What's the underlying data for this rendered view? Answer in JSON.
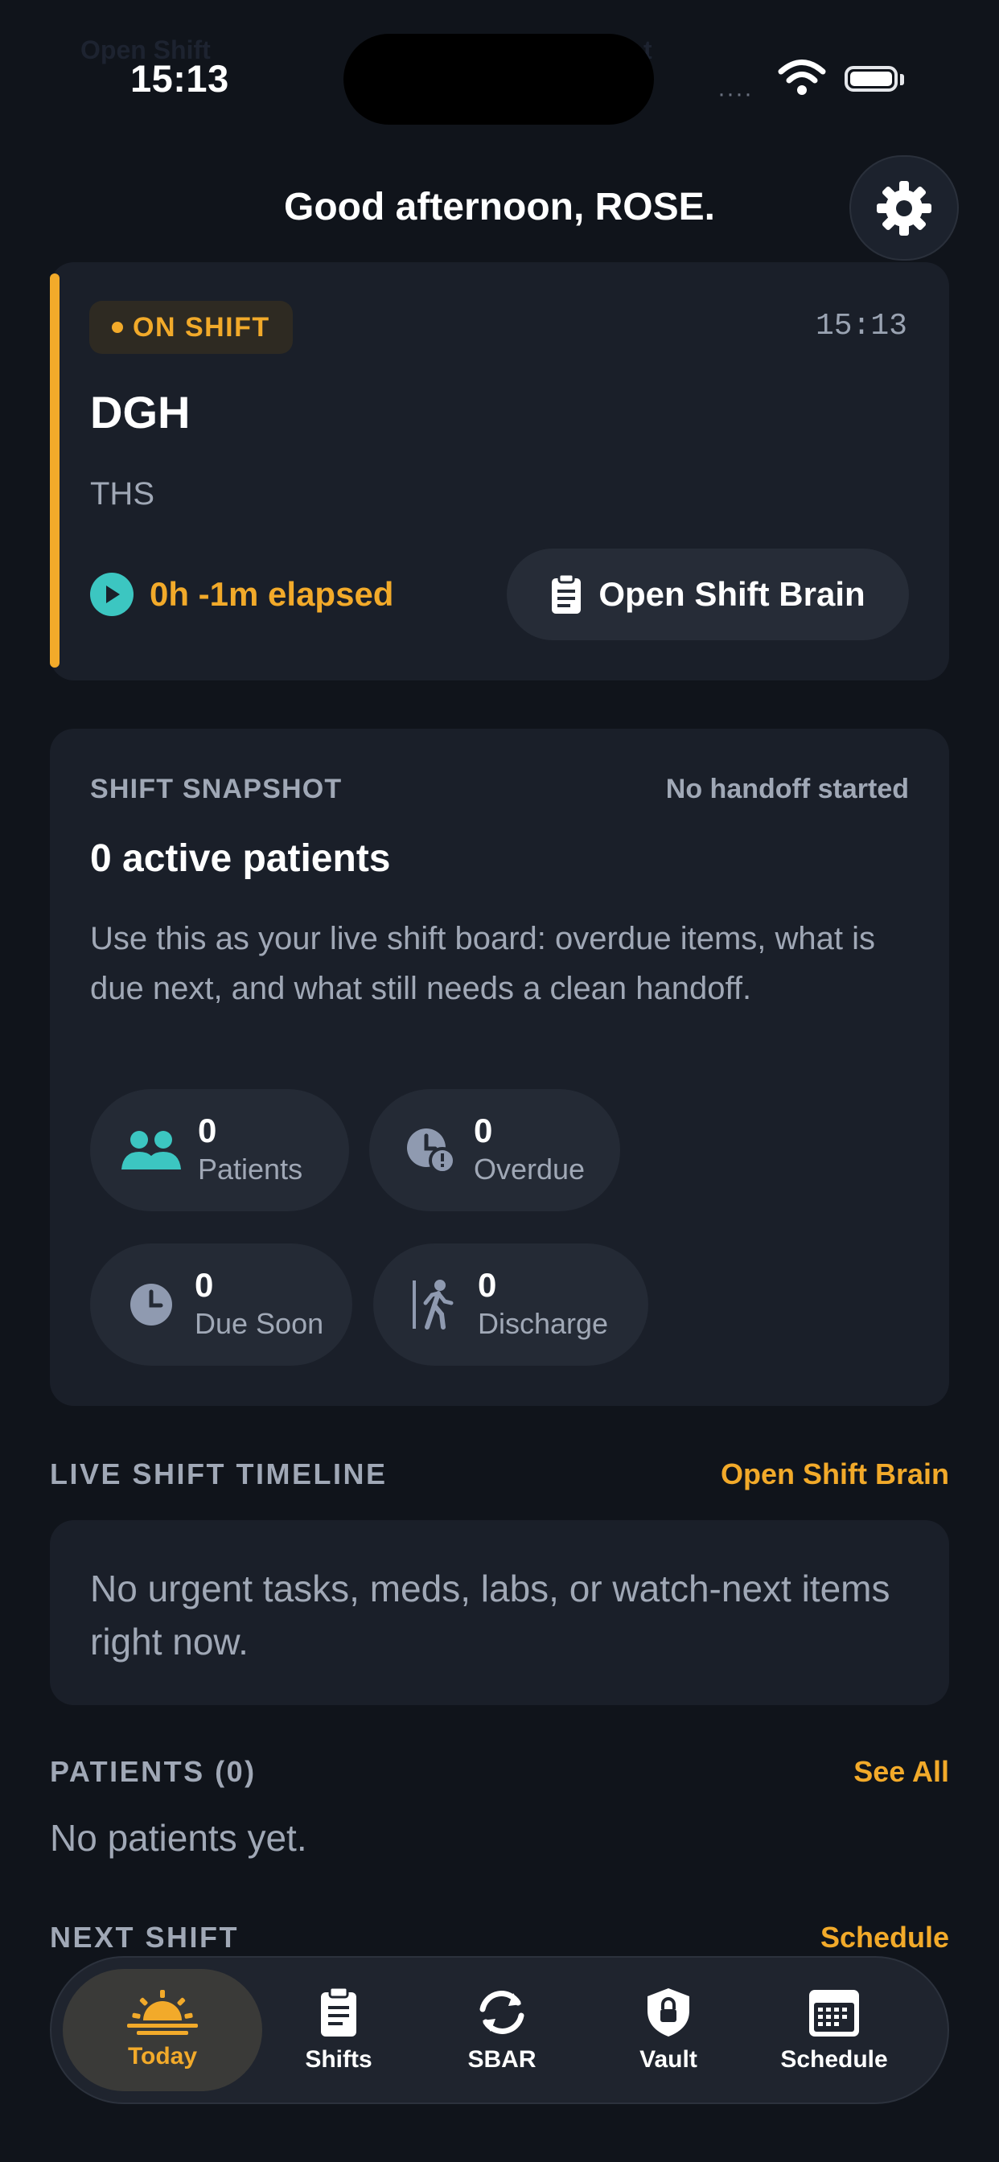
{
  "status_bar": {
    "time": "15:13",
    "signal": "····"
  },
  "greeting": "Good afternoon, ROSE.",
  "shift_card": {
    "badge": "ON SHIFT",
    "time": "15:13",
    "site": "DGH",
    "unit": "THS",
    "elapsed": "0h -1m elapsed",
    "open_brain_label": "Open Shift Brain"
  },
  "snapshot": {
    "label": "SHIFT SNAPSHOT",
    "handoff_status": "No handoff started",
    "active_patients": "0 active patients",
    "description": "Use this as your live shift board: overdue items, what is due next, and what still needs a clean handoff.",
    "stats": [
      {
        "value": "0",
        "label": "Patients",
        "icon": "people-icon"
      },
      {
        "value": "0",
        "label": "Overdue",
        "icon": "clock-alert-icon"
      },
      {
        "value": "0",
        "label": "Due Soon",
        "icon": "clock-icon"
      },
      {
        "value": "0",
        "label": "Discharge",
        "icon": "walking-person-icon"
      }
    ]
  },
  "timeline": {
    "title": "LIVE SHIFT TIMELINE",
    "link": "Open Shift Brain",
    "empty_text": "No urgent tasks, meds, labs, or watch-next items right now."
  },
  "patients": {
    "title": "PATIENTS (0)",
    "link": "See All",
    "empty_text": "No patients yet."
  },
  "next_shift": {
    "title": "NEXT SHIFT",
    "link": "Schedule"
  },
  "tabs": [
    {
      "label": "Today",
      "icon": "sunrise-icon"
    },
    {
      "label": "Shifts",
      "icon": "clipboard-icon"
    },
    {
      "label": "SBAR",
      "icon": "sync-icon"
    },
    {
      "label": "Vault",
      "icon": "shield-lock-icon"
    },
    {
      "label": "Schedule",
      "icon": "calendar-icon"
    }
  ],
  "colors": {
    "accent": "#f2aa2a",
    "teal": "#3cc6c1",
    "background": "#10141b",
    "card": "#1a1f29"
  }
}
